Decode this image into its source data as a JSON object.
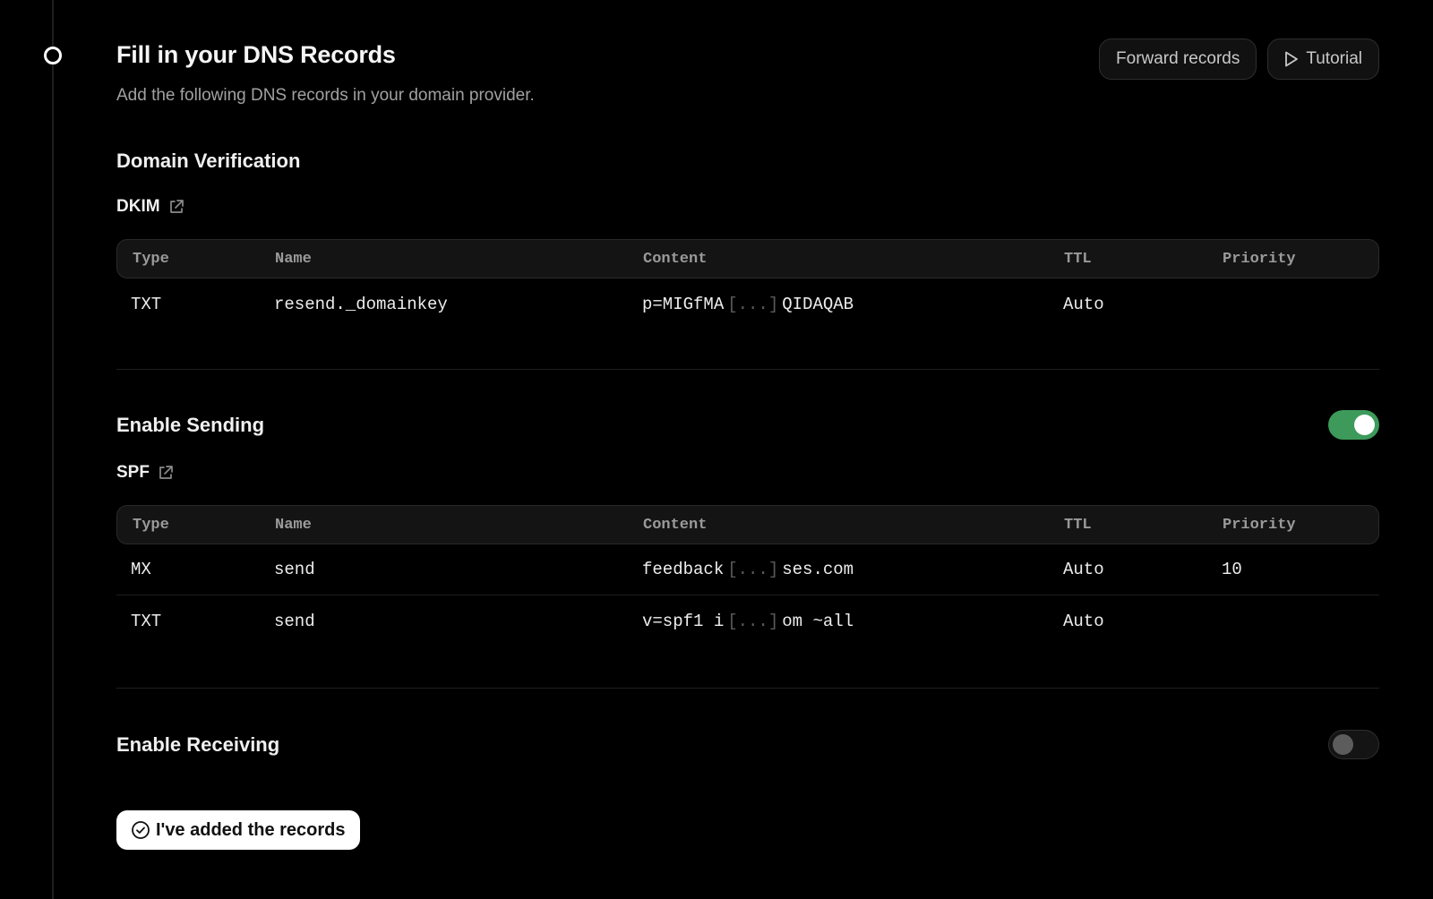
{
  "header": {
    "title": "Fill in your DNS Records",
    "subtitle": "Add the following DNS records in your domain provider.",
    "forward_label": "Forward records",
    "tutorial_label": "Tutorial"
  },
  "verification": {
    "title": "Domain Verification",
    "record_label": "DKIM",
    "columns": [
      "Type",
      "Name",
      "Content",
      "TTL",
      "Priority"
    ],
    "rows": [
      {
        "type": "TXT",
        "name": "resend._domainkey",
        "content_start": "p=MIGfMA",
        "content_end": "QIDAQAB",
        "ttl": "Auto",
        "priority": ""
      }
    ]
  },
  "sending": {
    "title": "Enable Sending",
    "enabled": true,
    "record_label": "SPF",
    "columns": [
      "Type",
      "Name",
      "Content",
      "TTL",
      "Priority"
    ],
    "rows": [
      {
        "type": "MX",
        "name": "send",
        "content_start": "feedback",
        "content_end": "ses.com",
        "ttl": "Auto",
        "priority": "10"
      },
      {
        "type": "TXT",
        "name": "send",
        "content_start": "v=spf1 i",
        "content_end": "om ~all",
        "ttl": "Auto",
        "priority": ""
      }
    ]
  },
  "receiving": {
    "title": "Enable Receiving",
    "enabled": false
  },
  "ellipsis": "[...]",
  "confirm_label": "I've added the records",
  "colors": {
    "background": "#000000",
    "toggle_on": "#3d9a5b",
    "toggle_off": "#141414",
    "muted_text": "#a1a1a1"
  },
  "icons": {
    "step": "step-dot-icon",
    "play": "play-icon",
    "external": "external-link-icon",
    "check": "check-circle-icon"
  }
}
